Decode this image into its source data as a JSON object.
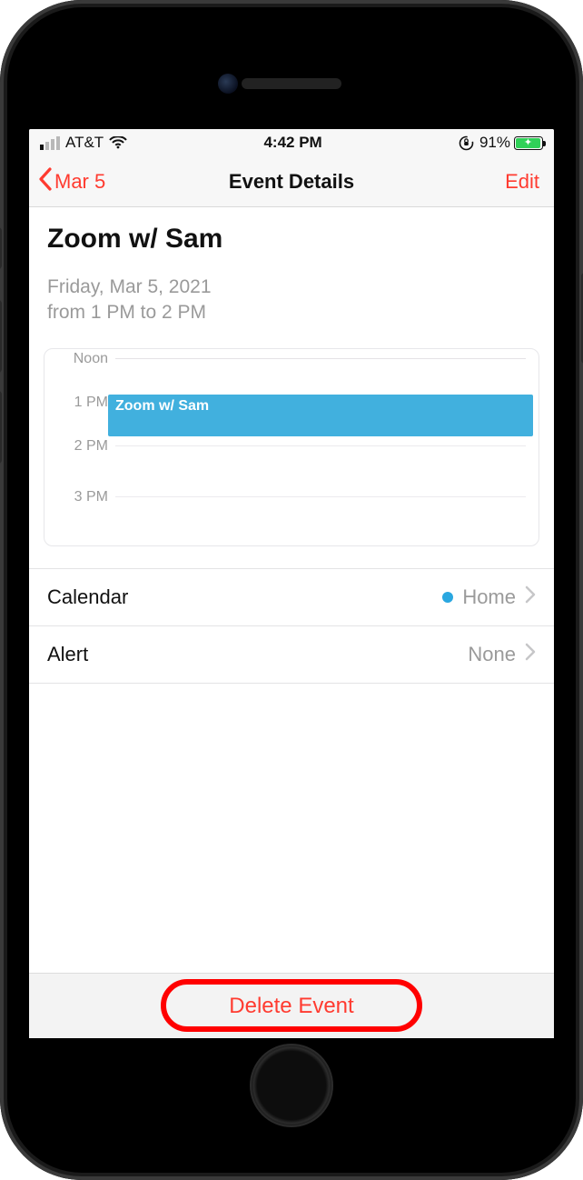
{
  "statusbar": {
    "carrier": "AT&T",
    "time": "4:42 PM",
    "battery_pct": "91%",
    "signal_bars_on": 1
  },
  "nav": {
    "back_label": "Mar 5",
    "title": "Event Details",
    "edit_label": "Edit"
  },
  "event": {
    "title": "Zoom w/ Sam",
    "date_line": "Friday, Mar 5, 2021",
    "time_line": "from 1 PM to 2 PM"
  },
  "timeline": {
    "labels": [
      "Noon",
      "1 PM",
      "2 PM",
      "3 PM"
    ],
    "block_label": "Zoom w/ Sam"
  },
  "rows": {
    "calendar": {
      "label": "Calendar",
      "value": "Home"
    },
    "alert": {
      "label": "Alert",
      "value": "None"
    }
  },
  "delete": {
    "label": "Delete Event"
  }
}
